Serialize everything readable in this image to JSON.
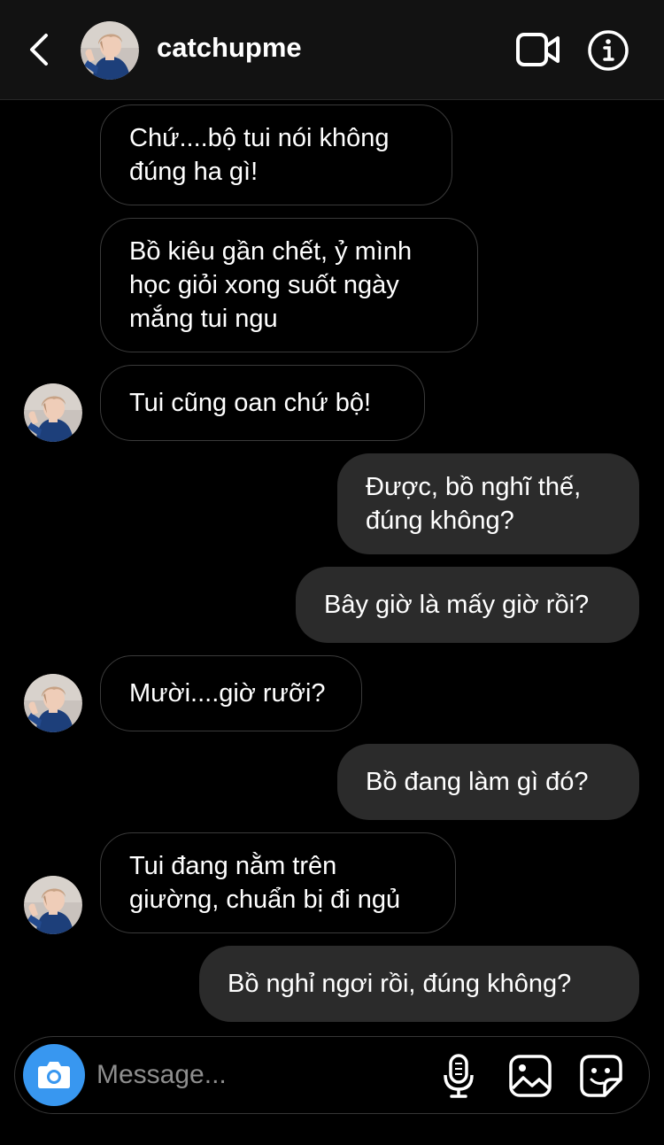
{
  "header": {
    "username": "catchupme",
    "icons": {
      "back": "chevron-left-icon",
      "video": "video-call-icon",
      "info": "info-icon"
    }
  },
  "messages": [
    {
      "sender": "them",
      "text": "Chứ....bộ tui nói không\nđúng ha gì!"
    },
    {
      "sender": "them",
      "text": "Bồ kiêu gần chết, ỷ mình\nhọc giỏi xong suốt ngày\nmắng tui ngu"
    },
    {
      "sender": "them",
      "text": "Tui cũng oan chứ bộ!"
    },
    {
      "sender": "me",
      "text": "Được, bồ nghĩ thế,\nđúng không?"
    },
    {
      "sender": "me",
      "text": "Bây giờ là mấy giờ rồi?"
    },
    {
      "sender": "them",
      "text": "Mười....giờ rưỡi?"
    },
    {
      "sender": "me",
      "text": "Bồ đang làm gì đó?"
    },
    {
      "sender": "them",
      "text": "Tui đang nằm trên\ngiường, chuẩn bị đi ngủ"
    },
    {
      "sender": "me",
      "text": "Bồ nghỉ ngơi rồi, đúng không?"
    }
  ],
  "composer": {
    "placeholder": "Message...",
    "value": "",
    "icons": {
      "camera": "camera-icon",
      "mic": "microphone-icon",
      "gallery": "image-gallery-icon",
      "sticker": "sticker-icon"
    }
  },
  "colors": {
    "background": "#000000",
    "header": "#121212",
    "outgoing_bubble": "#2b2b2b",
    "incoming_border": "#3a3a3a",
    "accent": "#3897f0",
    "placeholder": "#8e8e8e"
  }
}
